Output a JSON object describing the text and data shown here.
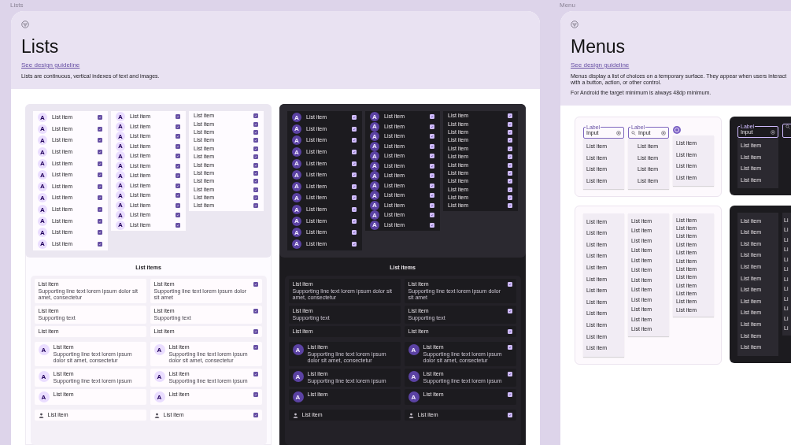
{
  "lists_frame": {
    "caption": "Lists",
    "title": "Lists",
    "link": "See design guideline",
    "paragraphs": [
      "Lists are continuous, vertical indexes of text and images."
    ],
    "panels": [
      {
        "dark": false,
        "columns": [
          {
            "kind": "avatar",
            "items": [
              {
                "avatar": "A",
                "label": "List item",
                "checked": true
              },
              {
                "avatar": "A",
                "label": "List item",
                "checked": true
              },
              {
                "avatar": "A",
                "label": "List item",
                "checked": true
              },
              {
                "avatar": "A",
                "label": "List item",
                "checked": true
              },
              {
                "avatar": "A",
                "label": "List item",
                "checked": true
              },
              {
                "avatar": "A",
                "label": "List item",
                "checked": true
              },
              {
                "avatar": "A",
                "label": "List item",
                "checked": true
              },
              {
                "avatar": "A",
                "label": "List item",
                "checked": true
              },
              {
                "avatar": "A",
                "label": "List item",
                "checked": true
              },
              {
                "avatar": "A",
                "label": "List item",
                "checked": true
              },
              {
                "avatar": "A",
                "label": "List item",
                "checked": true
              },
              {
                "avatar": "A",
                "label": "List item",
                "checked": true
              }
            ]
          },
          {
            "kind": "compact",
            "items": [
              {
                "avatar": "A",
                "label": "List item",
                "checked": true
              },
              {
                "avatar": "A",
                "label": "List item",
                "checked": true
              },
              {
                "avatar": "A",
                "label": "List item",
                "checked": true
              },
              {
                "avatar": "A",
                "label": "List item",
                "checked": true
              },
              {
                "avatar": "A",
                "label": "List item",
                "checked": true
              },
              {
                "avatar": "A",
                "label": "List item",
                "checked": true
              },
              {
                "avatar": "A",
                "label": "List item",
                "checked": true
              },
              {
                "avatar": "A",
                "label": "List item",
                "checked": true
              },
              {
                "avatar": "A",
                "label": "List item",
                "checked": true
              },
              {
                "avatar": "A",
                "label": "List item",
                "checked": true
              },
              {
                "avatar": "A",
                "label": "List item",
                "checked": true
              },
              {
                "avatar": "A",
                "label": "List item",
                "checked": true
              }
            ]
          },
          {
            "kind": "dense",
            "items": [
              {
                "label": "List item",
                "checked": true
              },
              {
                "label": "List item",
                "checked": true
              },
              {
                "label": "List item",
                "checked": true
              },
              {
                "label": "List item",
                "checked": true
              },
              {
                "label": "List item",
                "checked": true
              },
              {
                "label": "List item",
                "checked": true
              },
              {
                "label": "List item",
                "checked": true
              },
              {
                "label": "List item",
                "checked": true
              },
              {
                "label": "List item",
                "checked": true
              },
              {
                "label": "List item",
                "checked": true
              },
              {
                "label": "List item",
                "checked": true
              },
              {
                "label": "List item",
                "checked": true
              }
            ]
          }
        ],
        "section_title": "List items",
        "groups": [
          {
            "kind": "text",
            "rows": [
              [
                {
                  "label": "List item",
                  "support": "Supporting line text lorem ipsum dolor sit amet, consectetur"
                },
                {
                  "label": "List item",
                  "support": "Supporting line text lorem ipsum dolor sit amet",
                  "checked": true
                }
              ],
              [
                {
                  "label": "List item",
                  "support": "Supporting text"
                },
                {
                  "label": "List item",
                  "support": "Supporting text",
                  "checked": true
                }
              ],
              [
                {
                  "label": "List item"
                },
                {
                  "label": "List item",
                  "checked": true
                }
              ]
            ]
          },
          {
            "kind": "avatar",
            "rows": [
              [
                {
                  "avatar": "A",
                  "label": "List item",
                  "support": "Supporting line text lorem ipsum dolor sit amet, consectetur"
                },
                {
                  "avatar": "A",
                  "label": "List item",
                  "support": "Supporting line text lorem ipsum dolor sit amet, consectetur",
                  "checked": true
                }
              ],
              [
                {
                  "avatar": "A",
                  "label": "List item",
                  "support": "Supporting line text lorem ipsum"
                },
                {
                  "avatar": "A",
                  "label": "List item",
                  "support": "Supporting line text lorem ipsum",
                  "checked": true
                }
              ],
              [
                {
                  "avatar": "A",
                  "label": "List item"
                },
                {
                  "avatar": "A",
                  "label": "List item",
                  "checked": true
                }
              ]
            ]
          },
          {
            "kind": "person",
            "rows": [
              [
                {
                  "label": "List item"
                },
                {
                  "label": "List item",
                  "checked": true
                }
              ]
            ]
          }
        ]
      },
      {
        "dark": true,
        "columns": [
          {
            "kind": "avatar",
            "items": [
              {
                "avatar": "A",
                "label": "List item",
                "checked": true
              },
              {
                "avatar": "A",
                "label": "List item",
                "checked": true
              },
              {
                "avatar": "A",
                "label": "List item",
                "checked": true
              },
              {
                "avatar": "A",
                "label": "List item",
                "checked": true
              },
              {
                "avatar": "A",
                "label": "List item",
                "checked": true
              },
              {
                "avatar": "A",
                "label": "List item",
                "checked": true
              },
              {
                "avatar": "A",
                "label": "List item",
                "checked": true
              },
              {
                "avatar": "A",
                "label": "List item",
                "checked": true
              },
              {
                "avatar": "A",
                "label": "List item",
                "checked": true
              },
              {
                "avatar": "A",
                "label": "List item",
                "checked": true
              },
              {
                "avatar": "A",
                "label": "List item",
                "checked": true
              },
              {
                "avatar": "A",
                "label": "List item",
                "checked": true
              }
            ]
          },
          {
            "kind": "compact",
            "items": [
              {
                "avatar": "A",
                "label": "List item",
                "checked": true
              },
              {
                "avatar": "A",
                "label": "List item",
                "checked": true
              },
              {
                "avatar": "A",
                "label": "List item",
                "checked": true
              },
              {
                "avatar": "A",
                "label": "List item",
                "checked": true
              },
              {
                "avatar": "A",
                "label": "List item",
                "checked": true
              },
              {
                "avatar": "A",
                "label": "List item",
                "checked": true
              },
              {
                "avatar": "A",
                "label": "List item",
                "checked": true
              },
              {
                "avatar": "A",
                "label": "List item",
                "checked": true
              },
              {
                "avatar": "A",
                "label": "List item",
                "checked": true
              },
              {
                "avatar": "A",
                "label": "List item",
                "checked": true
              },
              {
                "avatar": "A",
                "label": "List item",
                "checked": true
              },
              {
                "avatar": "A",
                "label": "List item",
                "checked": true
              }
            ]
          },
          {
            "kind": "dense",
            "items": [
              {
                "label": "List item",
                "checked": true
              },
              {
                "label": "List item",
                "checked": true
              },
              {
                "label": "List item",
                "checked": true
              },
              {
                "label": "List item",
                "checked": true
              },
              {
                "label": "List item",
                "checked": true
              },
              {
                "label": "List item",
                "checked": true
              },
              {
                "label": "List item",
                "checked": true
              },
              {
                "label": "List item",
                "checked": true
              },
              {
                "label": "List item",
                "checked": true
              },
              {
                "label": "List item",
                "checked": true
              },
              {
                "label": "List item",
                "checked": true
              },
              {
                "label": "List item",
                "checked": true
              }
            ]
          }
        ],
        "section_title": "List items",
        "groups": [
          {
            "kind": "text",
            "rows": [
              [
                {
                  "label": "List item",
                  "support": "Supporting line text lorem ipsum dolor sit amet, consectetur"
                },
                {
                  "label": "List item",
                  "support": "Supporting line text lorem ipsum dolor sit amet",
                  "checked": true
                }
              ],
              [
                {
                  "label": "List item",
                  "support": "Supporting text"
                },
                {
                  "label": "List item",
                  "support": "Supporting text",
                  "checked": true
                }
              ],
              [
                {
                  "label": "List item"
                },
                {
                  "label": "List item",
                  "checked": true
                }
              ]
            ]
          },
          {
            "kind": "avatar",
            "rows": [
              [
                {
                  "avatar": "A",
                  "label": "List item",
                  "support": "Supporting line text lorem ipsum dolor sit amet, consectetur"
                },
                {
                  "avatar": "A",
                  "label": "List item",
                  "support": "Supporting line text lorem ipsum dolor sit amet, consectetur",
                  "checked": true
                }
              ],
              [
                {
                  "avatar": "A",
                  "label": "List item",
                  "support": "Supporting line text lorem ipsum"
                },
                {
                  "avatar": "A",
                  "label": "List item",
                  "support": "Supporting line text lorem ipsum",
                  "checked": true
                }
              ],
              [
                {
                  "avatar": "A",
                  "label": "List item"
                },
                {
                  "avatar": "A",
                  "label": "List item",
                  "checked": true
                }
              ]
            ]
          },
          {
            "kind": "person",
            "rows": [
              [
                {
                  "label": "List item"
                },
                {
                  "label": "List item",
                  "checked": true
                }
              ]
            ]
          }
        ]
      }
    ]
  },
  "menus_frame": {
    "caption": "Menu",
    "title": "Menus",
    "link": "See design guideline",
    "paragraphs": [
      "Menus display a list of choices on a temporary surface. They appear when users interact with a button, action, or other control.",
      "For Android the target minimum is always 48dp minimum."
    ],
    "boxes": [
      {
        "dark": false,
        "columns": [
          {
            "kind": "field",
            "field": {
              "label": "Label",
              "value": "Input"
            },
            "items": [
              "List item",
              "List item",
              "List item",
              "List item"
            ]
          },
          {
            "kind": "search",
            "field": {
              "label": "Label",
              "value": "Input"
            },
            "items": [
              "List item",
              "List item",
              "List item",
              "List item"
            ]
          },
          {
            "kind": "button",
            "items": [
              "List item",
              "List item",
              "List item",
              "List item"
            ]
          }
        ]
      },
      {
        "dark": true,
        "columns": [
          {
            "kind": "field",
            "field": {
              "label": "Label",
              "value": "Input"
            },
            "items": [
              "List item",
              "List item",
              "List item",
              "List item"
            ]
          },
          {
            "kind": "search"
          }
        ]
      },
      {
        "dark": false,
        "columns": [
          {
            "kind": "plain",
            "items": [
              "List item",
              "List item",
              "List item",
              "List item",
              "List item",
              "List item",
              "List item",
              "List item",
              "List item",
              "List item",
              "List item",
              "List item"
            ]
          },
          {
            "kind": "compact",
            "items": [
              "List item",
              "List item",
              "List item",
              "List item",
              "List item",
              "List item",
              "List item",
              "List item",
              "List item",
              "List item",
              "List item",
              "List item"
            ]
          },
          {
            "kind": "dense",
            "items": [
              "List item",
              "List item",
              "List item",
              "List item",
              "List item",
              "List item",
              "List item",
              "List item",
              "List item",
              "List item",
              "List item",
              "List item"
            ]
          }
        ]
      },
      {
        "dark": true,
        "columns": [
          {
            "kind": "plain",
            "items": [
              "List item",
              "List item",
              "List item",
              "List item",
              "List item",
              "List item",
              "List item",
              "List item",
              "List item",
              "List item",
              "List item",
              "List item"
            ]
          },
          {
            "kind": "compact",
            "items": [
              "Li",
              "Li",
              "Li",
              "Li",
              "Li",
              "Li",
              "Li",
              "Li",
              "Li",
              "Li",
              "Li",
              "Li"
            ]
          }
        ]
      }
    ]
  }
}
